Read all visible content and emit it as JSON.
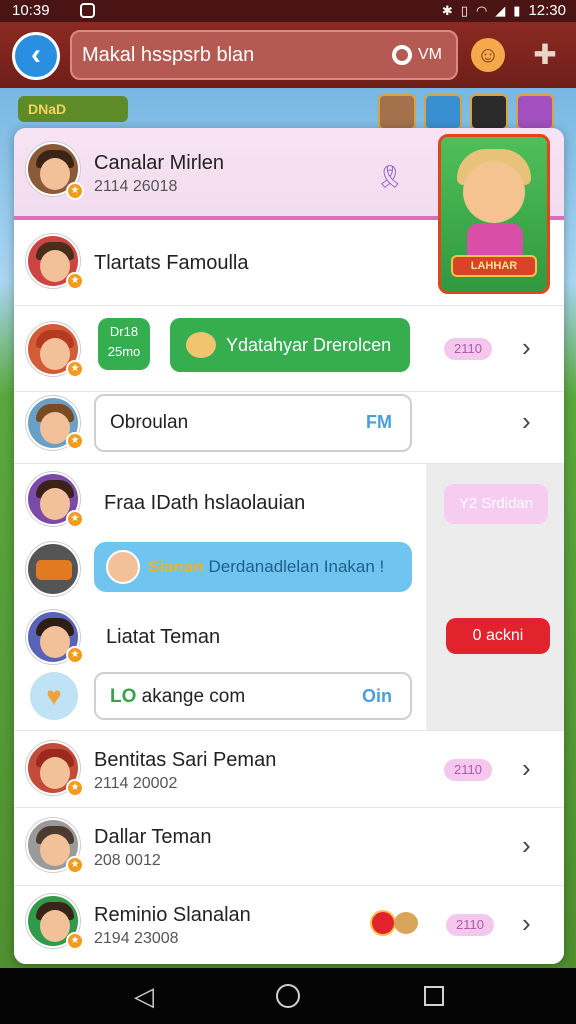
{
  "status_bar": {
    "time": "10:39",
    "right_time": "12:30",
    "icons": [
      "bluetooth-icon",
      "vibrate-icon",
      "wifi-icon",
      "signal-icon",
      "battery-icon"
    ]
  },
  "app_bar": {
    "search_text": "Makal hsspsrb blan",
    "search_tag": "VM"
  },
  "game_bg": {
    "banner": "DNaD"
  },
  "featured": {
    "plate_label": "LAHHAR"
  },
  "rows": [
    {
      "name": "Canalar Mirlen",
      "sub": "2114 26018"
    },
    {
      "name": "Tlartats Famoulla"
    },
    {
      "bubble": "Dr18 25mo",
      "chip": "Ydatahyar Drerolcen",
      "pill": "2110"
    },
    {
      "input": "Obroulan",
      "tag": "FM"
    },
    {
      "name": "Fraa IDath hslaolauian",
      "pill": "Y2 Srdidan"
    },
    {
      "chip_highlight": "Sianan",
      "chip": "Derdanadlelan Inakan !"
    },
    {
      "name": "Liatat Teman",
      "red_pill": "0 ackni"
    },
    {
      "input_prefix": "LO",
      "input": "akange com",
      "tag": "Oin"
    },
    {
      "name": "Bentitas Sari Peman",
      "sub": "2114 20002",
      "pill": "2110"
    },
    {
      "name": "Dallar Teman",
      "sub": "208 0012"
    },
    {
      "name": "Reminio Slanalan",
      "sub": "2194 23008",
      "pill": "2110"
    }
  ],
  "colors": {
    "accent_green": "#36ad4f",
    "accent_blue": "#6fc5ef",
    "accent_red": "#e2232d",
    "pill_pink": "#f4c7ef",
    "app_bar": "#8c2a22"
  }
}
